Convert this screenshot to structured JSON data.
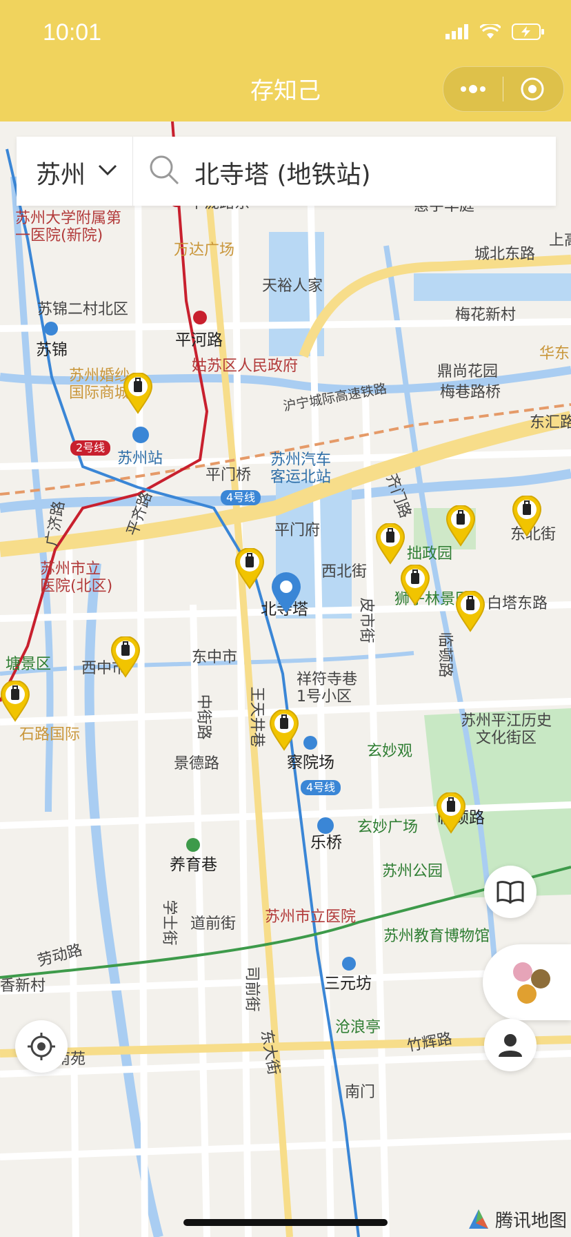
{
  "status": {
    "time": "10:01"
  },
  "nav": {
    "title": "存知己"
  },
  "search": {
    "city": "苏州",
    "query": "北寺塔 (地铁站)"
  },
  "map": {
    "provider": "腾讯地图",
    "labels": {
      "pinglonglu_e": "平泷路东",
      "wanda": "万达广场",
      "suda": "苏州大学附属第\n一医院(新院)",
      "tianyu": "天裕人家",
      "huiyu": "惠宇华庭",
      "chengbei": "城北东路",
      "shang": "上高",
      "sujin2": "苏锦二村北区",
      "suji_st": "苏锦",
      "pinghelu": "平河路",
      "meihua": "梅花新村",
      "gusu_gov": "姑苏区人民政府",
      "wedding": "苏州婚纱\n国际商城",
      "dingshang": "鼎尚花园",
      "huadong": "华东",
      "hu_ning": "沪宁城际高速铁路",
      "meixiang": "梅巷路桥",
      "dongjun": "东汇路",
      "line2": "2号线",
      "suzhou_st": "苏州站",
      "bus_north": "苏州汽车\n客运北站",
      "pingmen_br": "平门桥",
      "line4": "4号线",
      "pingmen_fu": "平门府",
      "qimen": "齐门路",
      "zhuozheng": "拙政园",
      "dongbei": "东北街",
      "xibei": "西北街",
      "beisita": "北寺塔",
      "shizi": "狮子林景区",
      "baita": "白塔东路",
      "shili": "苏州市立\n医院(北区)",
      "pishi": "皮市街",
      "dongzhong": "东中市",
      "xizhong": "西中市",
      "tangjing": "塘景区",
      "lindun": "临顿路",
      "xiangfu": "祥符寺巷\n1号小区",
      "zhongjie": "中街路",
      "wangtian": "王天井巷",
      "pingjiang": "苏州平江历史\n文化街区",
      "shilu": "石路国际",
      "xuanmiao": "玄妙观",
      "chayuan": "察院场",
      "jingde": "景德路",
      "line4b": "4号线",
      "lindun_st": "临顿路",
      "xuanmiao_sq": "玄妙广场",
      "leqiao": "乐桥",
      "yangyu": "养育巷",
      "suzhou_park": "苏州公园",
      "shili_h": "苏州市立医院",
      "daoqian": "道前街",
      "edu_mus": "苏州教育博物馆",
      "laodong": "劳动路",
      "xiang": "香新村",
      "sanyuan": "三元坊",
      "canglang": "沧浪亭",
      "taihan": "泰南苑",
      "zhuhui": "竹辉路",
      "nanmen": "南门",
      "xueshi": "学士街",
      "siqian": "司前街",
      "dongda": "东大街",
      "pingqi": "平齐路",
      "guangji": "广济路"
    }
  },
  "colors": {
    "brand": "#f0d35d",
    "water": "#a9cdf2",
    "park": "#c8e8c4",
    "metro_red": "#c8202e",
    "metro_blue": "#3a86d6",
    "metro_green": "#3d9a4a",
    "pin": "#f1c400"
  }
}
